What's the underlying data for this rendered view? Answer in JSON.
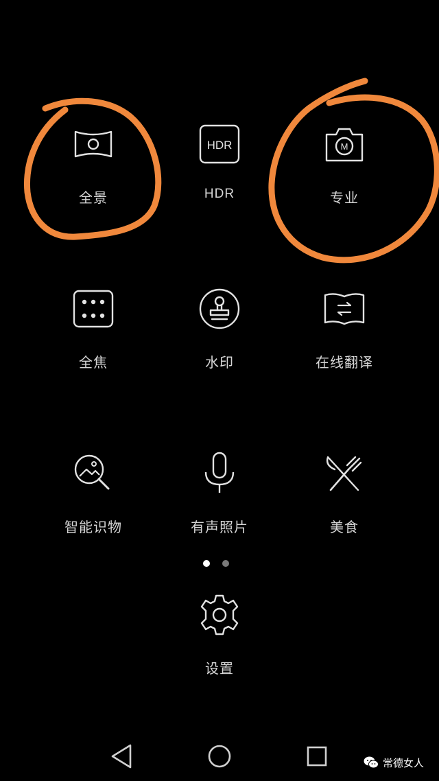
{
  "colors": {
    "background": "#000000",
    "icon_stroke": "#e2e2e2",
    "label": "#d6d6d6",
    "dot_active": "#ffffff",
    "dot_inactive": "#7a7a7a",
    "annotation": "#f0883c"
  },
  "modes": [
    {
      "label": "全景",
      "icon": "panorama-icon"
    },
    {
      "label": "HDR",
      "icon": "hdr-icon",
      "icon_text": "HDR"
    },
    {
      "label": "专业",
      "icon": "pro-camera-icon",
      "icon_text": "M"
    },
    {
      "label": "全焦",
      "icon": "all-focus-icon"
    },
    {
      "label": "水印",
      "icon": "watermark-stamp-icon"
    },
    {
      "label": "在线翻译",
      "icon": "translate-book-icon"
    },
    {
      "label": "智能识物",
      "icon": "object-recognition-icon"
    },
    {
      "label": "有声照片",
      "icon": "microphone-icon"
    },
    {
      "label": "美食",
      "icon": "food-utensils-icon"
    }
  ],
  "settings": {
    "label": "设置",
    "icon": "gear-icon"
  },
  "pager": {
    "page": 1,
    "total": 2
  },
  "nav": {
    "back": "back-triangle-icon",
    "home": "home-circle-icon",
    "recents": "recents-square-icon"
  },
  "watermark": {
    "text": "常德女人",
    "icon": "wechat-icon"
  }
}
